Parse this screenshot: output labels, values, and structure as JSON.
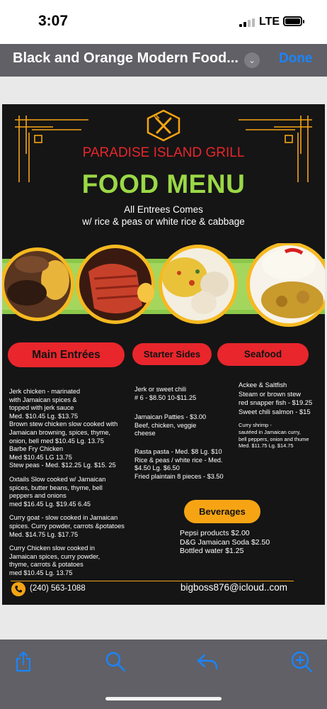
{
  "status_bar": {
    "time": "3:07",
    "network": "LTE"
  },
  "nav": {
    "title": "Black and Orange Modern Food...",
    "done_label": "Done"
  },
  "menu": {
    "restaurant_name": "PARADISE ISLAND GRILL",
    "headline": "FOOD MENU",
    "subtitle_line1": "All Entrees Comes",
    "subtitle_line2": "w/ rice & peas or white rice & cabbage",
    "sections": {
      "main": "Main Entrées",
      "starter": "Starter Sides",
      "seafood": "Seafood",
      "beverages": "Beverages"
    },
    "main_items": [
      "Jerk chicken - marinated\nwith Jamaican spices &\ntopped with jerk sauce\nMed. $10.45 Lg. $13.75",
      "Brown stew chicken slow cooked with\nJamaican browning, spices, thyme,\nonion, bell med $10.45 Lg. 13.75",
      "Barbe Fry Chicken\nMed $10.45  LG 13.75",
      "Stew peas - Med. $12.25 Lg. $15. 25",
      "Oxtails Slow cooked w/ Jamaican\nspices, butter beans, thyme, bell\npeppers and onions\nmed $16.45 Lg. $19.45 6.45",
      "Curry goat - slow cooked in Jamaican\nspices. Curry powder, carrots &potatoes\nMed. $14.75 Lg. $17.75",
      "Curry Chicken slow cooked in\nJamaican spices, curry powder,\nthyme, carrots & potatoes\n med $10.45 Lg. 13.75"
    ],
    "starter_items": [
      "Jerk or sweet chili\n# 6 - $8.50 10-$11.25",
      "Jamaican Patties - $3.00\nBeef, chicken, veggie\n cheese",
      "Rasta pasta - Med. $8 Lg. $10\nRice & peas / white rice - Med.\n$4.50 Lg. $6.50\nFried plaintain 8 pieces - $3.50"
    ],
    "seafood_items": [
      "Ackee & Saltfish\nSteam or brown stew\nred snapper fish - $19.25\nSweet chili salmon - $15",
      "Curry shrimp -\nsautéed in Jamaican curry,\nbell peppers, onion and thume\nMed. $11.75 Lg. $14.75"
    ],
    "beverages": [
      "Pepsi products $2.00",
      "D&G Jamaican Soda $2.50",
      "Bottled water $1.25"
    ],
    "phone": "(240) 563-1088",
    "email": "bigboss876@icloud..com"
  },
  "toolbar": {
    "icons": [
      "share-icon",
      "search-icon",
      "reply-icon",
      "markup-icon"
    ]
  },
  "colors": {
    "accent_red": "#e8262c",
    "accent_orange": "#f6a414",
    "accent_green": "#9bd846",
    "ios_blue": "#1a84ff"
  }
}
